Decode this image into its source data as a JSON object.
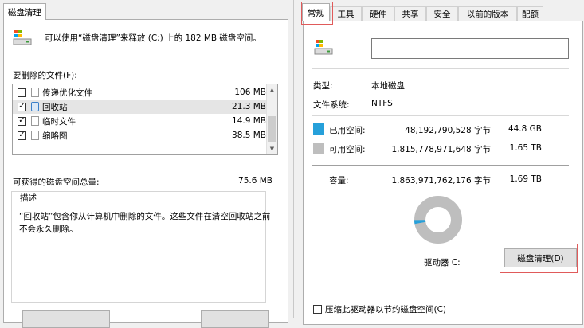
{
  "left_dialog": {
    "tab_label": "磁盘清理",
    "intro_text": "可以使用“磁盘清理”来释放 (C:) 上的 182 MB 磁盘空间。",
    "files_label": "要删除的文件(F):",
    "files": [
      {
        "name": "传递优化文件",
        "size": "106 MB",
        "checked": false,
        "icon": "file-icon"
      },
      {
        "name": "回收站",
        "size": "21.3 MB",
        "checked": true,
        "icon": "recycle-bin-icon"
      },
      {
        "name": "临时文件",
        "size": "14.9 MB",
        "checked": true,
        "icon": "file-icon"
      },
      {
        "name": "缩略图",
        "size": "38.5 MB",
        "checked": true,
        "icon": "file-icon"
      }
    ],
    "total_label": "可获得的磁盘空间总量:",
    "total_value": "75.6 MB",
    "description_legend": "描述",
    "description_text_line1": "“回收站”包含你从计算机中删除的文件。这些文件在清空回收站之前",
    "description_text_line2": "不会永久删除。"
  },
  "right_dialog": {
    "tabs": [
      "常规",
      "工具",
      "硬件",
      "共享",
      "安全",
      "以前的版本",
      "配额"
    ],
    "active_tab": "常规",
    "drive_name_value": "",
    "type_label": "类型:",
    "type_value": "本地磁盘",
    "fs_label": "文件系统:",
    "fs_value": "NTFS",
    "used_label": "已用空间:",
    "used_bytes": "48,192,790,528 字节",
    "used_size": "44.8 GB",
    "free_label": "可用空间:",
    "free_bytes": "1,815,778,971,648 字节",
    "free_size": "1.65 TB",
    "capacity_label": "容量:",
    "capacity_bytes": "1,863,971,762,176 字节",
    "capacity_size": "1.69 TB",
    "used_fraction": 0.0259,
    "drive_label": "驱动器 C:",
    "cleanup_button": "磁盘清理(D)",
    "compress_label": "压缩此驱动器以节约磁盘空间(C)",
    "compress_checked": false,
    "colors": {
      "used": "#26a0da",
      "free": "#bebebe",
      "highlight": "#e05a5a"
    }
  }
}
